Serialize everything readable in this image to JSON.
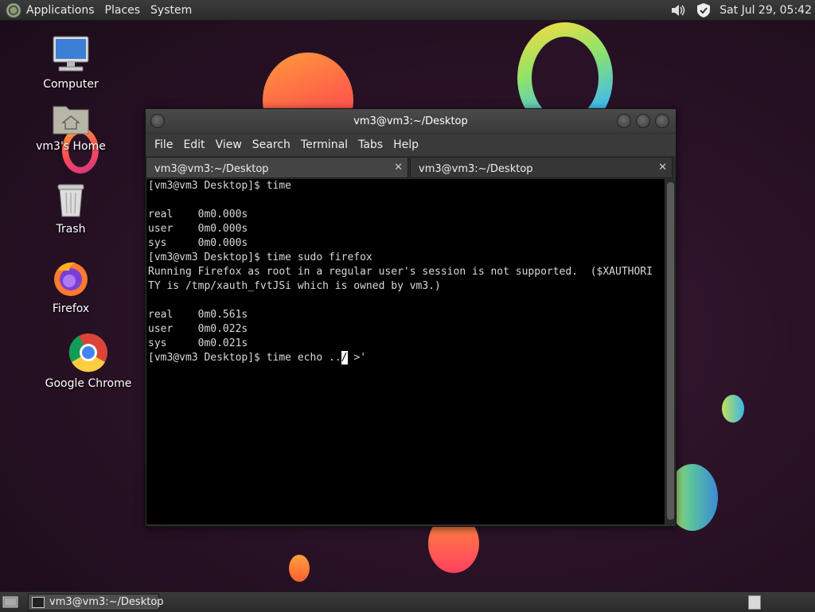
{
  "top_panel": {
    "menus": [
      "Applications",
      "Places",
      "System"
    ],
    "clock": "Sat Jul 29, 05:42"
  },
  "desktop_icons": [
    {
      "label": "Computer",
      "icon": "computer-icon"
    },
    {
      "label": "vm3's Home",
      "icon": "home-folder-icon"
    },
    {
      "label": "Trash",
      "icon": "trash-icon"
    },
    {
      "label": "Firefox",
      "icon": "firefox-icon"
    },
    {
      "label": "Google Chrome",
      "icon": "chrome-icon"
    }
  ],
  "terminal": {
    "title": "vm3@vm3:~/Desktop",
    "menu": [
      "File",
      "Edit",
      "View",
      "Search",
      "Terminal",
      "Tabs",
      "Help"
    ],
    "tabs": [
      {
        "label": "vm3@vm3:~/Desktop",
        "active": true
      },
      {
        "label": "vm3@vm3:~/Desktop",
        "active": false
      }
    ],
    "tab_close": "✕",
    "lines": [
      "[vm3@vm3 Desktop]$ time",
      "",
      "real    0m0.000s",
      "user    0m0.000s",
      "sys     0m0.000s",
      "[vm3@vm3 Desktop]$ time sudo firefox",
      "Running Firefox as root in a regular user's session is not supported.  ($XAUTHORI",
      "TY is /tmp/xauth_fvtJSi which is owned by vm3.)",
      "",
      "real    0m0.561s",
      "user    0m0.022s",
      "sys     0m0.021s"
    ],
    "prompt_before_cursor": "[vm3@vm3 Desktop]$ time echo ..",
    "prompt_at_cursor": "/",
    "prompt_after_cursor": " >'"
  },
  "taskbar": {
    "task_label": "vm3@vm3:~/Desktop"
  },
  "colors": {
    "terminal_bg": "#000000",
    "panel_bg": "#2f2f2f",
    "wallpaper_bg": "#2a1226"
  }
}
